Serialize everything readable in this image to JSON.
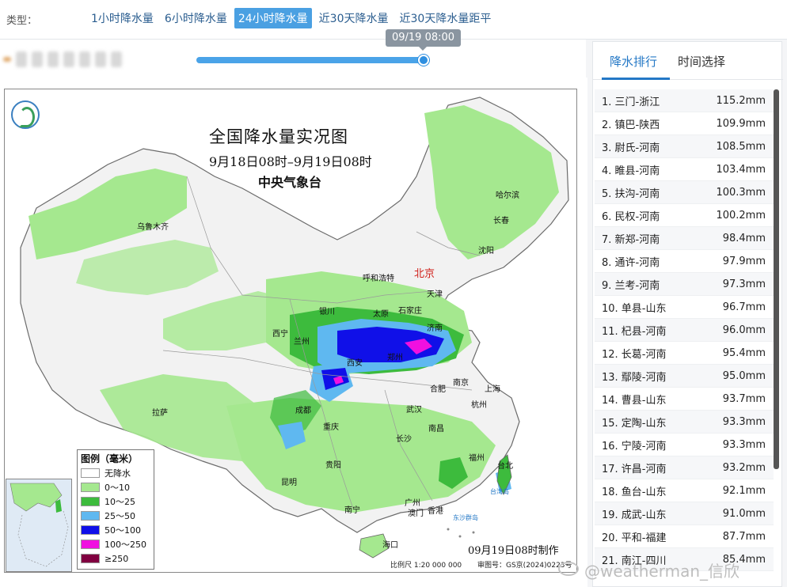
{
  "type_bar": {
    "label": "类型：",
    "tabs": [
      {
        "label": "1小时降水量",
        "active": false
      },
      {
        "label": "6小时降水量",
        "active": false
      },
      {
        "label": "24小时降水量",
        "active": true
      },
      {
        "label": "近30天降水量",
        "active": false
      },
      {
        "label": "近30天降水量距平",
        "active": false
      }
    ]
  },
  "time_slider": {
    "current_time": "09/19 08:00",
    "progress": 1.0
  },
  "map": {
    "title": "全国降水量实况图",
    "period": "9月18日08时–9月19日08时",
    "organization": "中央气象台",
    "made_time": "09月19日08时制作",
    "scale": "比例尺 1:20 000 000",
    "review_no": "审图号：GS京(2024)0223号",
    "cities": [
      "乌鲁木齐",
      "哈尔滨",
      "长春",
      "沈阳",
      "呼和浩特",
      "北京",
      "天津",
      "银川",
      "太原",
      "石家庄",
      "西宁",
      "兰州",
      "济南",
      "西安",
      "郑州",
      "合肥",
      "南京",
      "上海",
      "拉萨",
      "成都",
      "武汉",
      "杭州",
      "重庆",
      "长沙",
      "南昌",
      "贵阳",
      "福州",
      "台北",
      "昆明",
      "南宁",
      "广州",
      "香港",
      "澳门",
      "海口",
      "台湾岛",
      "东沙群岛"
    ],
    "legend": {
      "title": "图例（毫米）",
      "items": [
        {
          "label": "无降水",
          "color": "#ffffff"
        },
        {
          "label": "0～10",
          "color": "#a5e88f"
        },
        {
          "label": "10～25",
          "color": "#3dbb3d"
        },
        {
          "label": "25～50",
          "color": "#5fb8f0"
        },
        {
          "label": "50～100",
          "color": "#1010e8"
        },
        {
          "label": "100～250",
          "color": "#f010e0"
        },
        {
          "label": "≥250",
          "color": "#800040"
        }
      ]
    }
  },
  "right_panel": {
    "tabs": [
      {
        "label": "降水排行",
        "active": true
      },
      {
        "label": "时间选择",
        "active": false
      }
    ],
    "ranking": [
      {
        "name": "1. 三门-浙江",
        "value": "115.2mm"
      },
      {
        "name": "2. 镇巴-陕西",
        "value": "109.9mm"
      },
      {
        "name": "3. 尉氏-河南",
        "value": "108.5mm"
      },
      {
        "name": "4. 睢县-河南",
        "value": "103.4mm"
      },
      {
        "name": "5. 扶沟-河南",
        "value": "100.3mm"
      },
      {
        "name": "6. 民权-河南",
        "value": "100.2mm"
      },
      {
        "name": "7. 新郑-河南",
        "value": "98.4mm"
      },
      {
        "name": "8. 通许-河南",
        "value": "97.9mm"
      },
      {
        "name": "9. 兰考-河南",
        "value": "97.3mm"
      },
      {
        "name": "10. 单县-山东",
        "value": "96.7mm"
      },
      {
        "name": "11. 杞县-河南",
        "value": "96.0mm"
      },
      {
        "name": "12. 长葛-河南",
        "value": "95.4mm"
      },
      {
        "name": "13. 鄢陵-河南",
        "value": "95.0mm"
      },
      {
        "name": "14. 曹县-山东",
        "value": "93.7mm"
      },
      {
        "name": "15. 定陶-山东",
        "value": "93.3mm"
      },
      {
        "name": "16. 宁陵-河南",
        "value": "93.3mm"
      },
      {
        "name": "17. 许昌-河南",
        "value": "93.2mm"
      },
      {
        "name": "18. 鱼台-山东",
        "value": "92.1mm"
      },
      {
        "name": "19. 成武-山东",
        "value": "91.0mm"
      },
      {
        "name": "20. 平和-福建",
        "value": "87.7mm"
      },
      {
        "name": "21. 南江-四川",
        "value": "85.4mm"
      }
    ]
  },
  "watermark": "@weatherman_信欣"
}
